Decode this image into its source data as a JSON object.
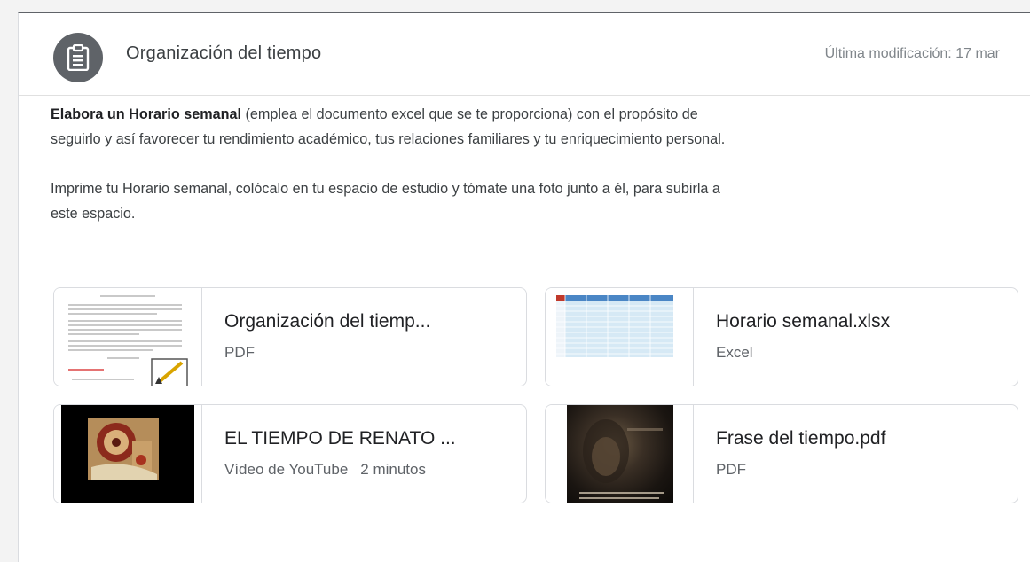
{
  "post": {
    "title": "Organización del tiempo",
    "modified": "Última modificación: 17 mar",
    "icon": "assignment-icon",
    "paragraph1_bold": "Elabora un Horario semanal",
    "paragraph1_rest": " (emplea el documento excel que se te proporciona) con el propósito de seguirlo y así favorecer tu rendimiento académico, tus relaciones familiares y tu enriquecimiento personal.",
    "paragraph2": "Imprime tu Horario semanal, colócalo en tu espacio de estudio y tómate una foto junto a él, para subirla a este espacio."
  },
  "attachments": [
    {
      "name": "Organización del tiemp...",
      "type": "PDF",
      "duration": ""
    },
    {
      "name": "Horario semanal.xlsx",
      "type": "Excel",
      "duration": ""
    },
    {
      "name": "EL TIEMPO DE RENATO ...",
      "type": "Vídeo de YouTube",
      "duration": "2 minutos"
    },
    {
      "name": "Frase del tiempo.pdf",
      "type": "PDF",
      "duration": ""
    }
  ],
  "colors": {
    "avatar": "#5f6368",
    "border": "#dadce0",
    "excel_header": "#4a86c5",
    "excel_cells": "#d6e9f5"
  }
}
